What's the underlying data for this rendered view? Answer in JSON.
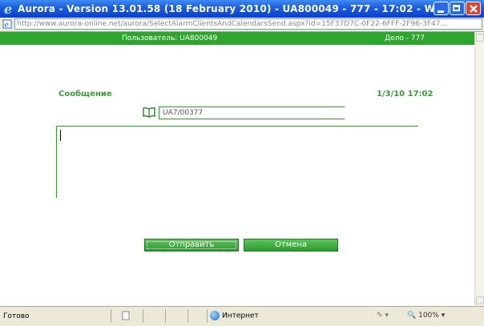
{
  "window": {
    "title": "Aurora - Version 13.01.58 (18 February 2010) - UA800049 - 777 - 17:02 - Wi..."
  },
  "address": {
    "url": "http://www.aurora-online.net/aurora/SelectAlarmClientsAndCalendarsSend.aspx?id=15F37D7C-0F22-6FFF-2F96-3F47..."
  },
  "header": {
    "user_label": "Пользователь: UA800049",
    "case_label": "Дело - 777"
  },
  "form": {
    "message_label": "Сообщение",
    "date": "1/3/10 17:02",
    "recipient_value": "UA7/00377",
    "message_text": ""
  },
  "buttons": {
    "send": "Отправить",
    "cancel": "Отмена"
  },
  "status": {
    "text": "Готово",
    "zone": "Интернет",
    "zoom": "100%"
  },
  "icons": {
    "window": "ie-icon",
    "address": "page-icon",
    "addressbook": "book-icon",
    "zone": "globe-icon"
  },
  "colors": {
    "accent_green": "#2ea52e",
    "title_blue": "#1d5fe0"
  }
}
